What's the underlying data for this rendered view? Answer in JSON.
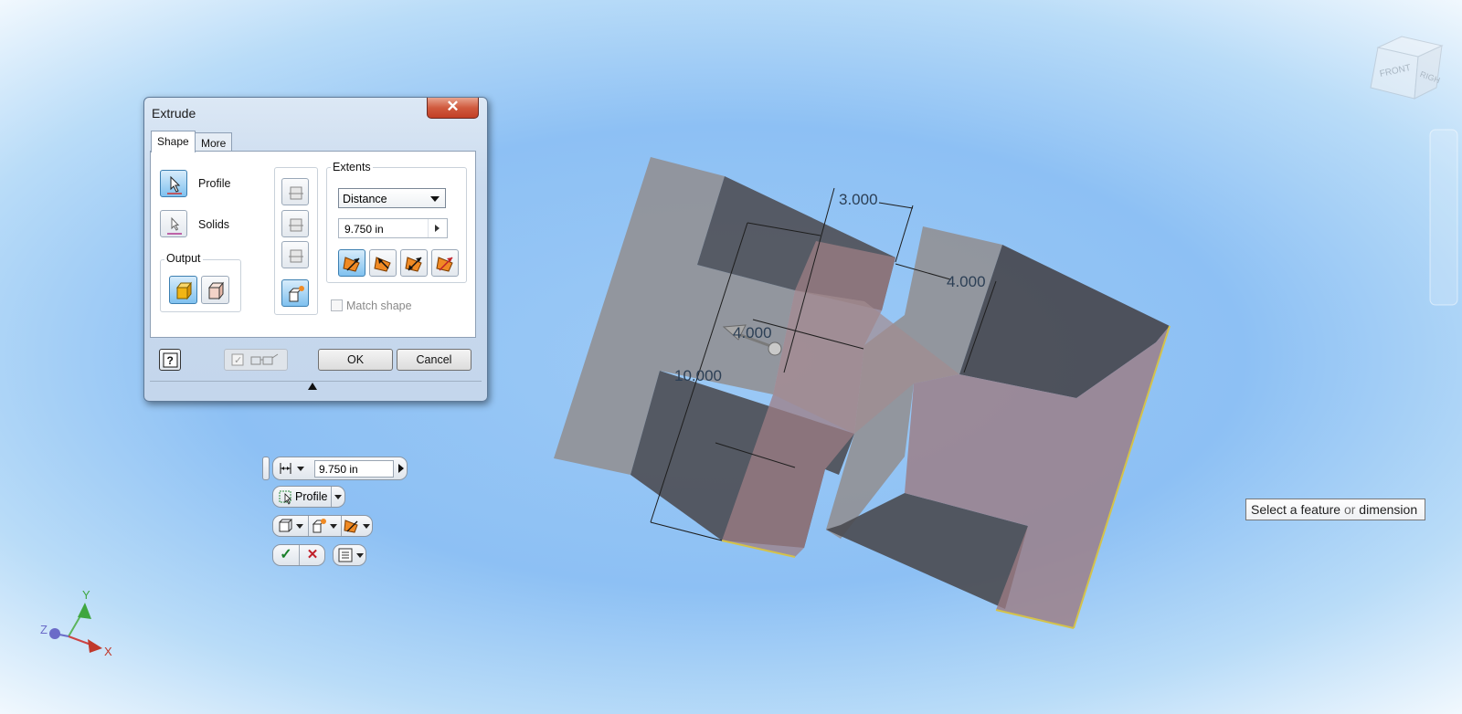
{
  "dialog": {
    "title": "Extrude",
    "close_glyph": "✕",
    "tabs": [
      {
        "label": "Shape"
      },
      {
        "label": "More"
      }
    ],
    "profile_label": "Profile",
    "solids_label": "Solids",
    "output_label": "Output",
    "extents_label": "Extents",
    "extents_type": "Distance",
    "distance_value": "9.750 in",
    "match_shape_label": "Match shape",
    "ok_label": "OK",
    "cancel_label": "Cancel",
    "help_glyph": "?",
    "preview_checked": true,
    "preview_glyph": "✓"
  },
  "mini_toolbar": {
    "distance_value": "9.750 in",
    "profile_label": "Profile",
    "ok_glyph": "✓",
    "cancel_glyph": "✕"
  },
  "dimensions": {
    "top_width": "3.000",
    "right_height": "4.000",
    "center_depth": "4.000",
    "left_height": "10.000"
  },
  "view_cube": {
    "front": "FRONT",
    "right": "RIGH"
  },
  "triad": {
    "x": "X",
    "y": "Y",
    "z": "Z"
  },
  "status_tooltip": {
    "prefix": "Select a feature",
    "or": "or",
    "suffix": "dimension"
  },
  "colors": {
    "viewport_blue": "#8dc0f4",
    "part_gray": "#8f8f94",
    "part_dark": "#4a4a50",
    "preview_pink": "#9e7e84",
    "accent_selected": "#7fc1ef",
    "close_red": "#c23f25"
  },
  "icons": [
    "cursor-select-icon",
    "profile-icon",
    "solid-join-icon",
    "surface-icon",
    "direction-icon",
    "taper-icon",
    "checkmark-icon",
    "close-icon",
    "help-icon",
    "glasses-icon"
  ]
}
